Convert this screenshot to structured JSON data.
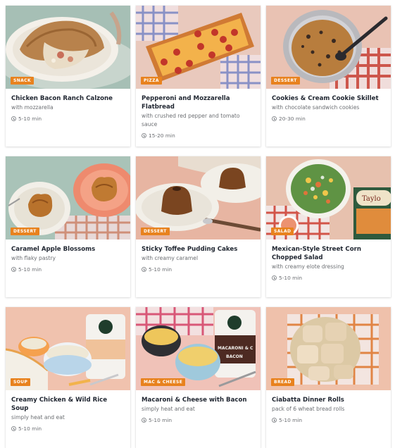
{
  "accent": "#e8821e",
  "cards": [
    {
      "badge": "SNACK",
      "title": "Chicken Bacon Ranch Calzone",
      "subtitle": "with mozzarella",
      "time": "5-10 min",
      "image": "calzone-photo"
    },
    {
      "badge": "PIZZA",
      "title": "Pepperoni and Mozzarella Flatbread",
      "subtitle": "with crushed red pepper and tomato sauce",
      "time": "15-20 min",
      "image": "flatbread-photo"
    },
    {
      "badge": "DESSERT",
      "title": "Cookies & Cream Cookie Skillet",
      "subtitle": "with chocolate sandwich cookies",
      "time": "20-30 min",
      "image": "cookie-skillet-photo"
    },
    {
      "badge": "DESSERT",
      "title": "Caramel Apple Blossoms",
      "subtitle": "with flaky pastry",
      "time": "5-10 min",
      "image": "apple-blossoms-photo"
    },
    {
      "badge": "DESSERT",
      "title": "Sticky Toffee Pudding Cakes",
      "subtitle": "with creamy caramel",
      "time": "5-10 min",
      "image": "toffee-cakes-photo"
    },
    {
      "badge": "SALAD",
      "title": "Mexican-Style Street Corn Chopped Salad",
      "subtitle": "with creamy elote dressing",
      "time": "5-10 min",
      "image": "corn-salad-photo"
    },
    {
      "badge": "SOUP",
      "title": "Creamy Chicken & Wild Rice Soup",
      "subtitle": "simply heat and eat",
      "time": "5-10 min",
      "image": "wild-rice-soup-photo"
    },
    {
      "badge": "MAC & CHEESE",
      "title": "Macaroni & Cheese with Bacon",
      "subtitle": "simply heat and eat",
      "time": "5-10 min",
      "image": "mac-cheese-photo"
    },
    {
      "badge": "BREAD",
      "title": "Ciabatta Dinner Rolls",
      "subtitle": "pack of 6 wheat bread rolls",
      "time": "5-10 min",
      "image": "ciabatta-rolls-photo"
    }
  ]
}
